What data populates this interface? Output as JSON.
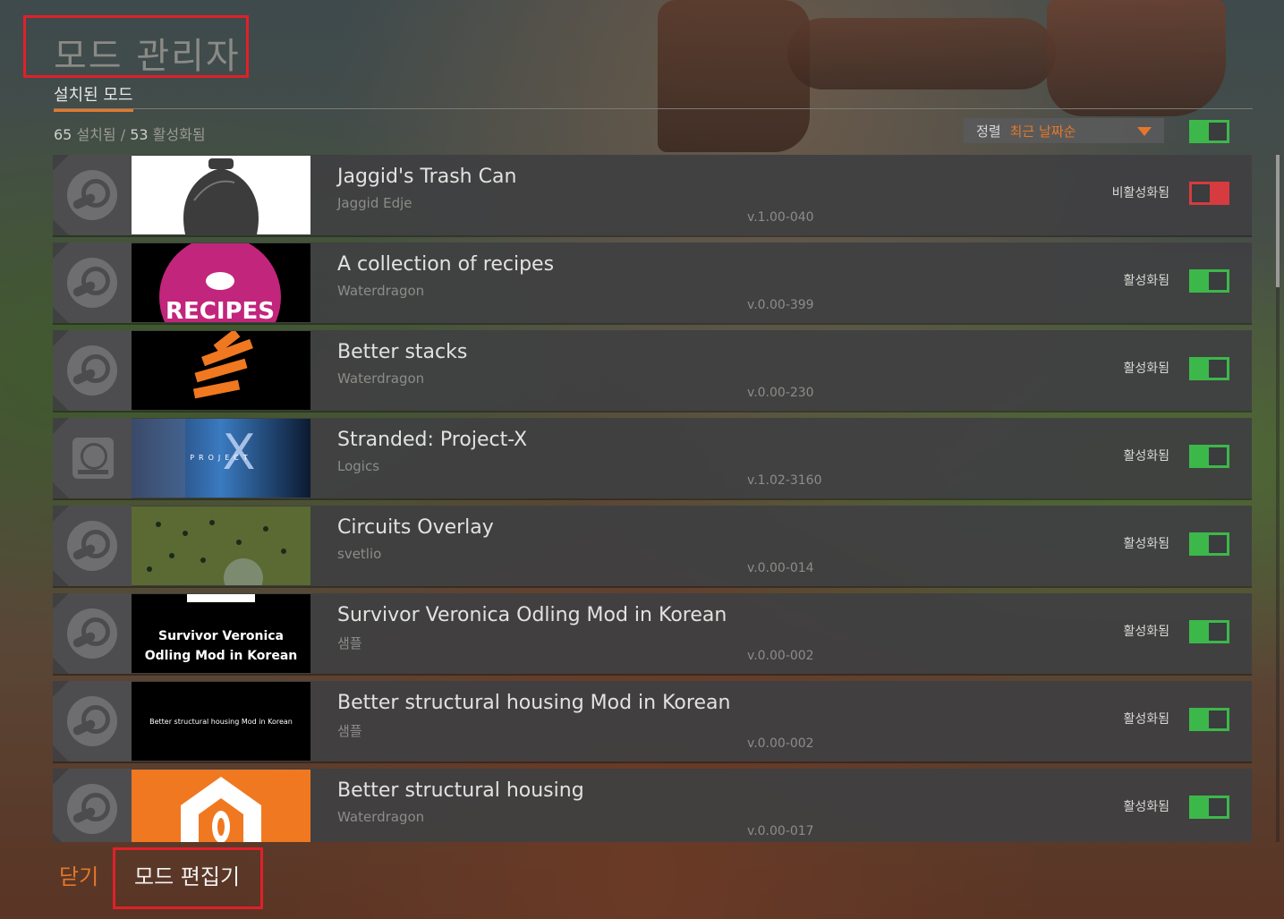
{
  "header": {
    "title": "모드 관리자",
    "tab_installed": "설치된 모드"
  },
  "stats": {
    "installed_count": "65",
    "installed_label": "설치됨",
    "separator": "/",
    "active_count": "53",
    "active_label": "활성화됨"
  },
  "sort": {
    "label": "정렬",
    "value": "최근 날짜순",
    "arrow_icon": "chevron-down-icon"
  },
  "master_toggle": {
    "state": "on"
  },
  "colors": {
    "accent": "#e4782a",
    "toggle_on": "#3cb84a",
    "toggle_off": "#d63b3f",
    "highlight_border": "#e0202a"
  },
  "mods": [
    {
      "name": "Jaggid's Trash Can",
      "author": "Jaggid Edje",
      "version": "v.1.00-040",
      "status": "비활성화됨",
      "enabled": false,
      "source": "steam-icon"
    },
    {
      "name": "A collection of recipes",
      "author": "Waterdragon",
      "version": "v.0.00-399",
      "status": "활성화됨",
      "enabled": true,
      "source": "steam-icon",
      "thumb_text": "RECIPES"
    },
    {
      "name": "Better stacks",
      "author": "Waterdragon",
      "version": "v.0.00-230",
      "status": "활성화됨",
      "enabled": true,
      "source": "steam-icon"
    },
    {
      "name": "Stranded: Project-X",
      "author": "Logics",
      "version": "v.1.02-3160",
      "status": "활성화됨",
      "enabled": true,
      "source": "hard-drive-icon",
      "thumb_text": "PROJECT"
    },
    {
      "name": "Circuits Overlay",
      "author": "svetlio",
      "version": "v.0.00-014",
      "status": "활성화됨",
      "enabled": true,
      "source": "steam-icon"
    },
    {
      "name": "Survivor Veronica Odling Mod in Korean",
      "author": "샘플",
      "version": "v.0.00-002",
      "status": "활성화됨",
      "enabled": true,
      "source": "steam-icon",
      "thumb_text_1": "Survivor Veronica",
      "thumb_text_2": "Odling Mod in Korean"
    },
    {
      "name": "Better structural housing Mod in Korean",
      "author": "샘플",
      "version": "v.0.00-002",
      "status": "활성화됨",
      "enabled": true,
      "source": "steam-icon",
      "thumb_text": "Better structural housing Mod in Korean"
    },
    {
      "name": "Better structural housing",
      "author": "Waterdragon",
      "version": "v.0.00-017",
      "status": "활성화됨",
      "enabled": true,
      "source": "steam-icon"
    }
  ],
  "footer": {
    "close_label": "닫기",
    "editor_label": "모드 편집기"
  }
}
